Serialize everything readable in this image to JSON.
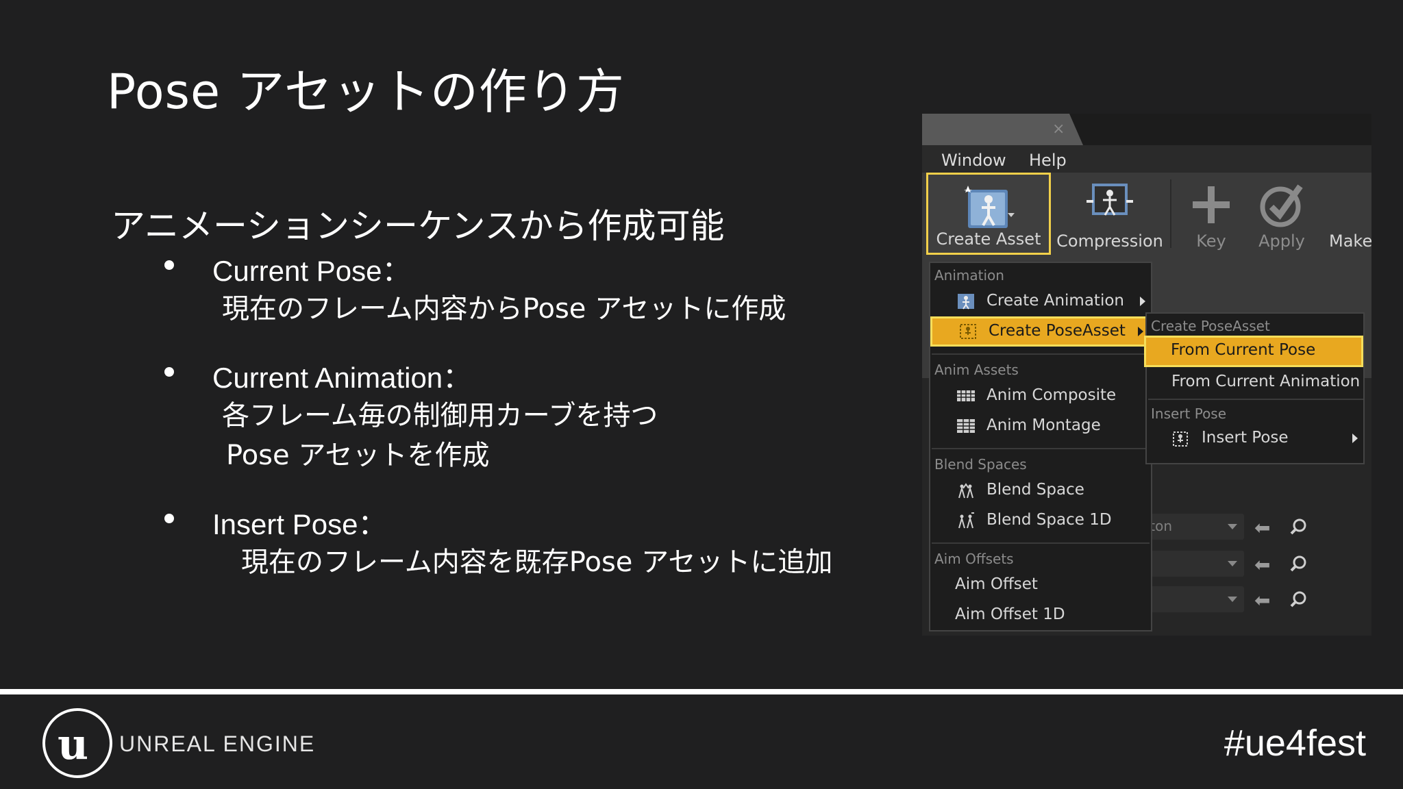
{
  "slide": {
    "title": "Pose アセットの作り方",
    "subtitle": "アニメーションシーケンスから作成可能",
    "bullets": [
      {
        "head": "Current Pose：",
        "lines": [
          "現在のフレーム内容からPose アセットに作成"
        ]
      },
      {
        "head": "Current Animation：",
        "lines": [
          "各フレーム毎の制御用カーブを持つ",
          "Pose アセットを作成"
        ]
      },
      {
        "head": "Insert Pose：",
        "lines": [
          "現在のフレーム内容を既存Pose アセットに追加"
        ]
      }
    ]
  },
  "editor": {
    "menubar": [
      "Window",
      "Help"
    ],
    "toolbar": {
      "create_asset": "Create Asset",
      "compression": "Compression",
      "key": "Key",
      "apply": "Apply",
      "make": "Make"
    },
    "menu": {
      "animation_header": "Animation",
      "create_animation": "Create Animation",
      "create_pose_asset": "Create PoseAsset",
      "anim_assets_header": "Anim Assets",
      "anim_composite": "Anim Composite",
      "anim_montage": "Anim Montage",
      "blend_spaces_header": "Blend Spaces",
      "blend_space": "Blend Space",
      "blend_space_1d": "Blend Space 1D",
      "aim_offsets_header": "Aim Offsets",
      "aim_offset": "Aim Offset",
      "aim_offset_1d": "Aim Offset 1D"
    },
    "submenu": {
      "create_pose_asset_header": "Create PoseAsset",
      "from_current_pose": "From Current Pose",
      "from_current_animation": "From Current Animation",
      "insert_pose_header": "Insert Pose",
      "insert_pose": "Insert Pose"
    },
    "behind_rows": {
      "skeleton_fragment": "eton"
    },
    "colors": {
      "highlight": "#e8a820",
      "highlight_border": "#f6de5a"
    }
  },
  "footer": {
    "brand": "UNREAL ENGINE",
    "hashtag": "#ue4fest"
  }
}
